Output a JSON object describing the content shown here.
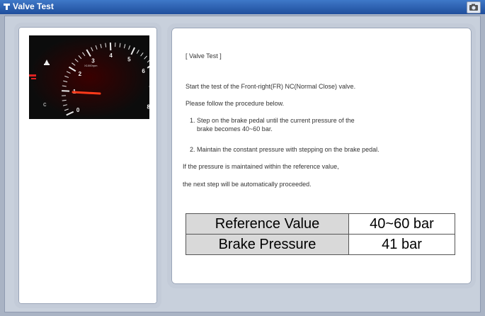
{
  "window": {
    "title": "Valve Test",
    "title_icon": "valve-icon",
    "camera_icon": "camera-icon"
  },
  "gauge": {
    "ticks": [
      "0",
      "1",
      "2",
      "3",
      "4",
      "5",
      "6",
      "7",
      "8"
    ],
    "unit": "X1000rpm",
    "needle_value": 1.1
  },
  "instructions": {
    "heading": "[ Valve Test ]",
    "line1": "Start the test of the Front-right(FR) NC(Normal Close) valve.",
    "line2": "Please follow the procedure below.",
    "step1a": "1. Step on the brake pedal until the current pressure of the",
    "step1b": "brake becomes 40~60 bar.",
    "step2": "2. Maintain the constant pressure with stepping on the brake pedal.",
    "line3": "If the pressure is maintained within the reference value,",
    "line4": "the next step will be automatically proceeded."
  },
  "table": {
    "rows": [
      {
        "label": "Reference Value",
        "value": "40~60 bar"
      },
      {
        "label": "Brake Pressure",
        "value": "41 bar"
      }
    ]
  }
}
